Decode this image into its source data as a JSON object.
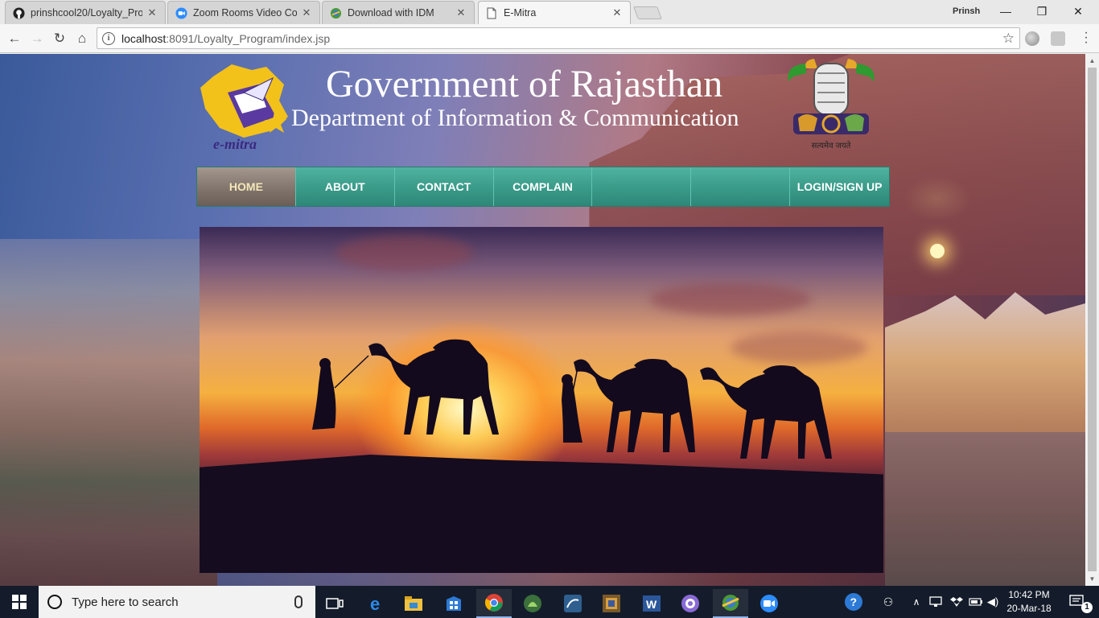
{
  "browser": {
    "tabs": [
      {
        "title": "prinshcool20/Loyalty_Pro",
        "icon": "github-icon",
        "active": false
      },
      {
        "title": "Zoom Rooms Video Conf",
        "icon": "zoom-icon",
        "active": false
      },
      {
        "title": "Download with IDM",
        "icon": "idm-icon",
        "active": false
      },
      {
        "title": "E-Mitra",
        "icon": "page-icon",
        "active": true
      }
    ],
    "profile_name": "Prinsh",
    "url_host": "localhost",
    "url_path": ":8091/Loyalty_Program/index.jsp"
  },
  "page": {
    "title": "Government of Rajasthan",
    "subtitle": "Department of Information & Communication",
    "logo_text": "e-mitra",
    "emblem_text": "सत्यमेव जयते",
    "nav": [
      {
        "label": "HOME",
        "active": true
      },
      {
        "label": "ABOUT",
        "active": false
      },
      {
        "label": "CONTACT",
        "active": false
      },
      {
        "label": "COMPLAIN",
        "active": false
      },
      {
        "label": "",
        "active": false
      },
      {
        "label": "",
        "active": false
      },
      {
        "label": "LOGIN/SIGN UP",
        "active": false
      }
    ],
    "colors": {
      "nav_teal": "#3a9a88",
      "nav_active": "#7e726a",
      "nav_active_text": "#f3e6b8"
    }
  },
  "taskbar": {
    "search_placeholder": "Type here to search",
    "time": "10:42 PM",
    "date": "20-Mar-18",
    "notification_count": "1",
    "apps": [
      "task-view-icon",
      "edge-icon",
      "file-explorer-icon",
      "store-icon",
      "chrome-icon",
      "android-studio-icon",
      "mysql-workbench-icon",
      "netbeans-icon",
      "word-icon",
      "teams-icon",
      "idm-icon",
      "zoom-icon"
    ]
  }
}
